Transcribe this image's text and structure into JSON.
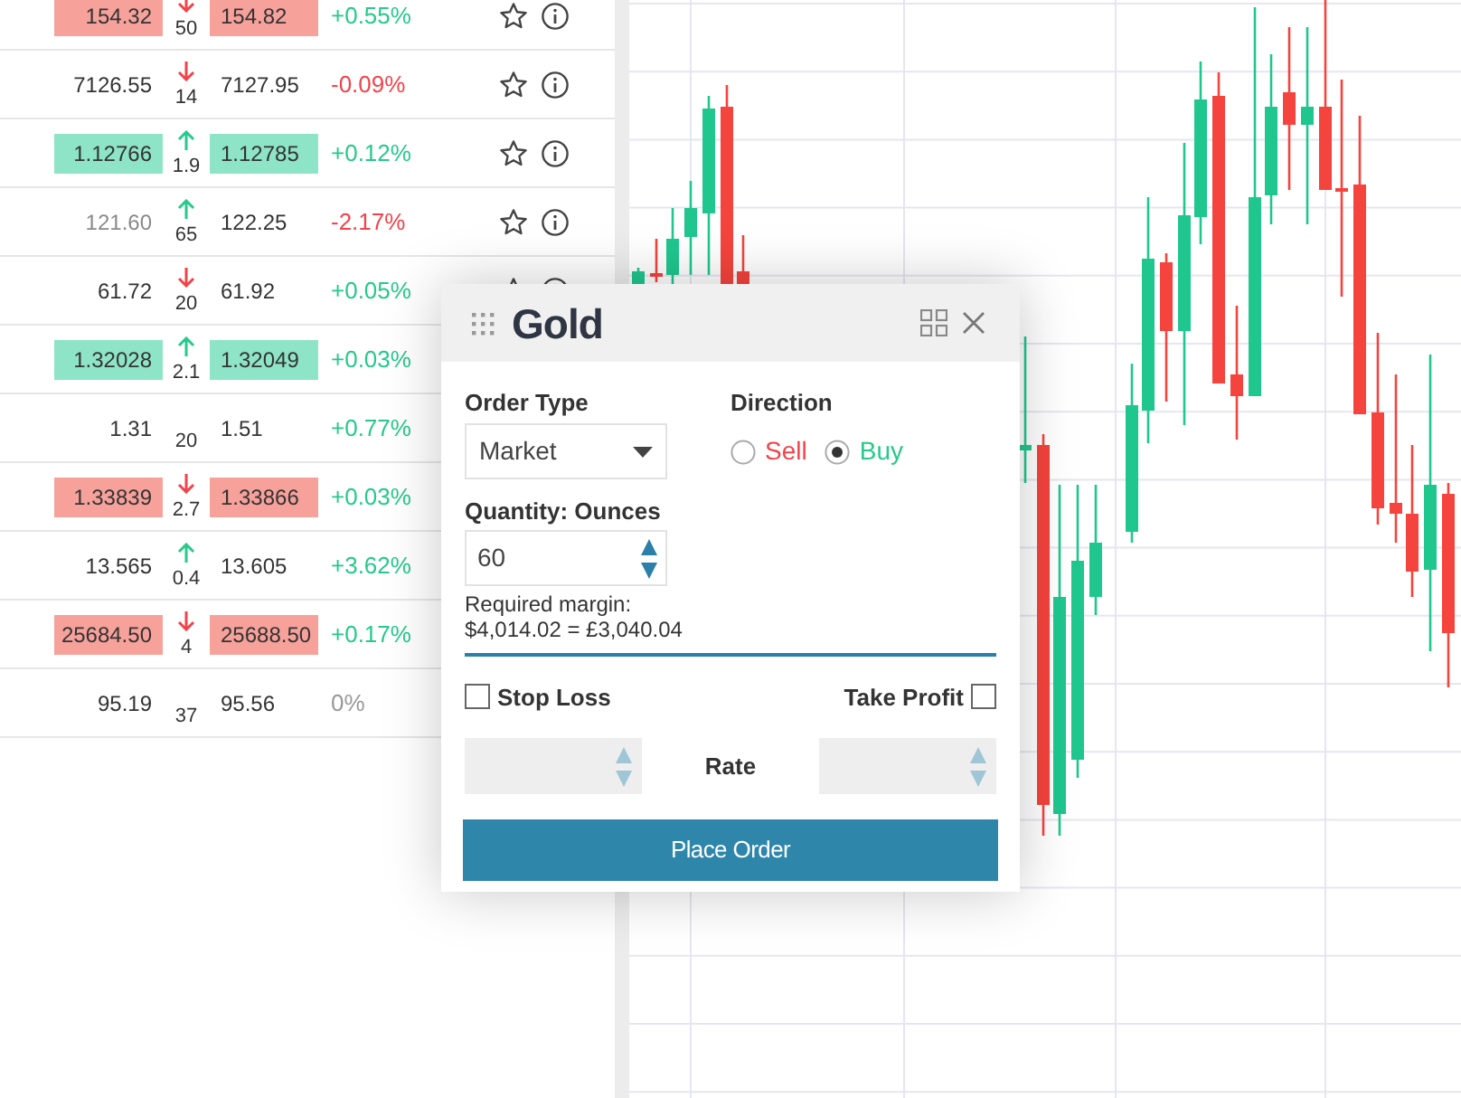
{
  "quotes": [
    {
      "bid": "154.32",
      "ask": "154.82",
      "spread": "50",
      "trend_up": false,
      "color": "#f7a19b",
      "change": {
        "text": "+0.55%",
        "color": "#27c98c"
      },
      "dimmed": false,
      "favorite": false
    },
    {
      "bid": "7126.55",
      "ask": "7127.95",
      "spread": "14",
      "trend_up": false,
      "change": {
        "text": "-0.09%",
        "color": "#f2434b"
      },
      "dimmed": false,
      "favorite": false
    },
    {
      "bid": "1.12766",
      "ask": "1.12785",
      "spread": "1.9",
      "trend_up": true,
      "color": "#8ee4c6",
      "change": {
        "text": "+0.12%",
        "color": "#27c98c"
      },
      "dimmed": false,
      "favorite": false
    },
    {
      "bid": "121.60",
      "ask": "122.25",
      "spread": "65",
      "trend_up": true,
      "change": {
        "text": "-2.17%",
        "color": "#f2434b"
      },
      "dimmed": true,
      "favorite": false
    },
    {
      "bid": "61.72",
      "ask": "61.92",
      "spread": "20",
      "trend_up": false,
      "change": {
        "text": "+0.05%",
        "color": "#27c98c"
      },
      "dimmed": false,
      "favorite": false
    },
    {
      "bid": "1.32028",
      "ask": "1.32049",
      "spread": "2.1",
      "trend_up": true,
      "color": "#8ee4c6",
      "change": {
        "text": "+0.03%",
        "color": "#27c98c"
      },
      "dimmed": false
    },
    {
      "bid": "1.31",
      "ask": "1.51",
      "spread": "20",
      "change": {
        "text": "+0.77%",
        "color": "#27c98c"
      },
      "dimmed": false
    },
    {
      "bid": "1.33839",
      "ask": "1.33866",
      "spread": "2.7",
      "trend_up": false,
      "color": "#f7a19b",
      "change": {
        "text": "+0.03%",
        "color": "#27c98c"
      },
      "dimmed": false
    },
    {
      "bid": "13.565",
      "ask": "13.605",
      "spread": "0.4",
      "trend_up": true,
      "change": {
        "text": "+3.62%",
        "color": "#27c98c"
      },
      "dimmed": false
    },
    {
      "bid": "25684.50",
      "ask": "25688.50",
      "spread": "4",
      "trend_up": false,
      "color": "#f7a19b",
      "change": {
        "text": "+0.17%",
        "color": "#27c98c"
      },
      "dimmed": false
    },
    {
      "bid": "95.19",
      "ask": "95.56",
      "spread": "37",
      "change": {
        "text": "0%",
        "color": "#999999"
      },
      "dimmed": false
    }
  ],
  "order_ticket": {
    "title": "Gold",
    "order_type": {
      "label": "Order Type",
      "value": "Market"
    },
    "direction": {
      "label": "Direction",
      "options": [
        {
          "label": "Sell",
          "kind": "sell",
          "selected": false
        },
        {
          "label": "Buy",
          "kind": "buy",
          "selected": true
        }
      ]
    },
    "quantity": {
      "label": "Quantity: Ounces",
      "value": "60"
    },
    "margin_label": "Required margin:",
    "margin_value": "$4,014.02 = £3,040.04",
    "stop_loss": {
      "label": "Stop Loss",
      "checked": false
    },
    "take_profit": {
      "label": "Take Profit",
      "checked": false
    },
    "rate_label": "Rate",
    "button": "Place Order"
  }
}
